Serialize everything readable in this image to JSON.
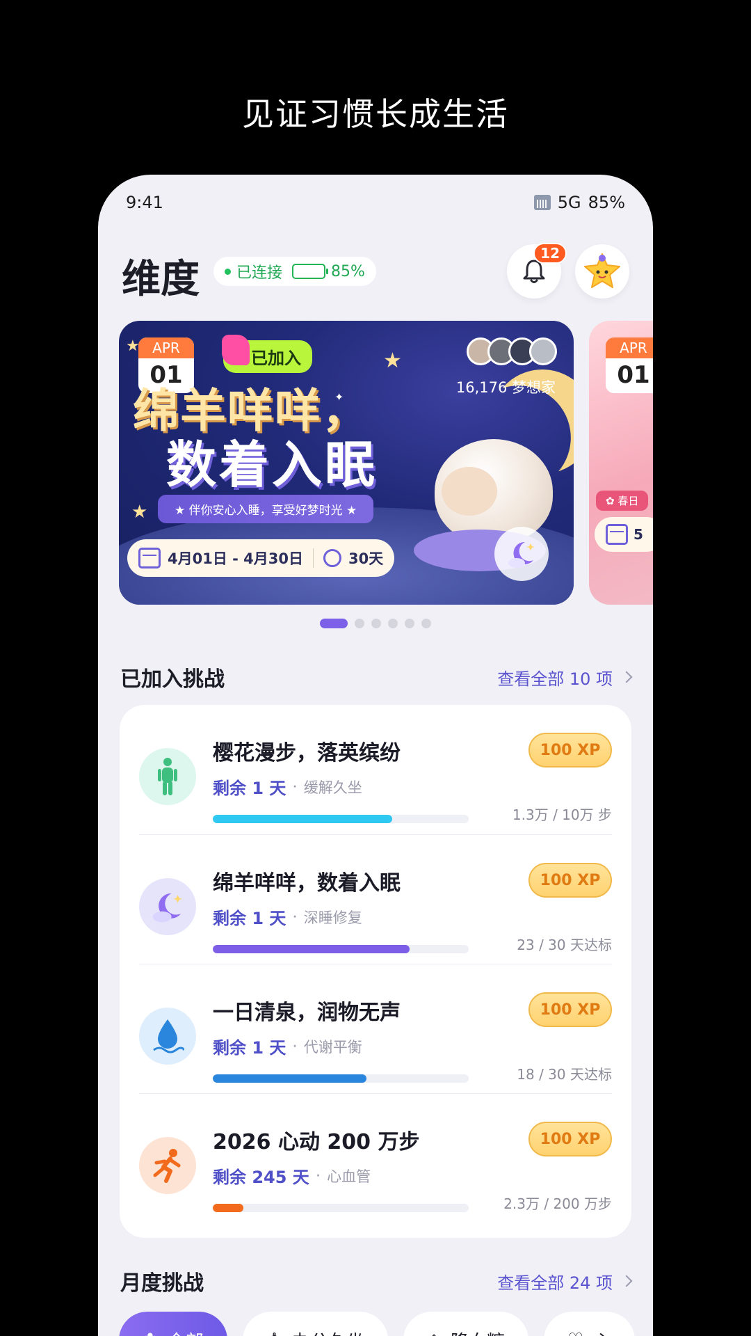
{
  "headline": "见证习惯长成生活",
  "status": {
    "time": "9:41",
    "network": "5G",
    "battery": "85%"
  },
  "header": {
    "brand": "维度",
    "connection_label": "已连接",
    "device_battery": "85%",
    "device_battery_level": 0.85,
    "notification_count": "12"
  },
  "banner": {
    "month": "APR",
    "day": "01",
    "joined_label": "已加入",
    "title_line1": "绵羊咩咩，",
    "title_line2": "数着入眠",
    "tagline": "伴你安心入睡，享受好梦时光",
    "date_range": "4月01日 - 4月30日",
    "duration": "30天",
    "member_count": "16,176 梦想家"
  },
  "banner_next": {
    "month": "APR",
    "day": "01",
    "tag": "春日",
    "date": "5"
  },
  "carousel": {
    "pages": 6,
    "active": 0
  },
  "joined_section": {
    "title": "已加入挑战",
    "view_all": "查看全部 10 项",
    "items": [
      {
        "title": "樱花漫步，落英缤纷",
        "remaining": "剩余 1 天",
        "tag": "缓解久坐",
        "xp": "100 XP",
        "progress_text": "1.3万 / 10万 步",
        "progress": 0.7,
        "color": "#2fc8f0",
        "icon": "walking-person-icon"
      },
      {
        "title": "绵羊咩咩，数着入眠",
        "remaining": "剩余 1 天",
        "tag": "深睡修复",
        "xp": "100 XP",
        "progress_text": "23 / 30 天达标",
        "progress": 0.77,
        "color": "#7d5ee6",
        "icon": "moon-cloud-icon"
      },
      {
        "title": "一日清泉，润物无声",
        "remaining": "剩余 1 天",
        "tag": "代谢平衡",
        "xp": "100 XP",
        "progress_text": "18 / 30 天达标",
        "progress": 0.6,
        "color": "#2a86dc",
        "icon": "water-drop-icon"
      },
      {
        "title": "2026 心动 200 万步",
        "remaining": "剩余 245 天",
        "tag": "心血管",
        "xp": "100 XP",
        "progress_text": "2.3万 / 200 万步",
        "progress": 0.12,
        "color": "#f26a1c",
        "icon": "running-person-icon"
      }
    ]
  },
  "monthly_section": {
    "title": "月度挑战",
    "view_all": "查看全部 24 项",
    "filters": [
      "全部",
      "办公久坐",
      "降血糖",
      "心"
    ]
  }
}
